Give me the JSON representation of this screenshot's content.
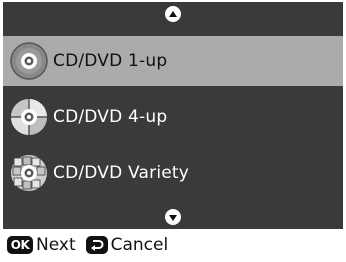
{
  "menu": {
    "items": [
      {
        "label": "CD/DVD 1-up",
        "icon": "disc-1up-icon",
        "selected": true
      },
      {
        "label": "CD/DVD 4-up",
        "icon": "disc-4up-icon",
        "selected": false
      },
      {
        "label": "CD/DVD Variety",
        "icon": "disc-variety-icon",
        "selected": false
      }
    ]
  },
  "footer": {
    "ok_key": "OK",
    "ok_label": "Next",
    "back_label": "Cancel"
  },
  "colors": {
    "screen_bg": "#3a3a3a",
    "selected_bg": "#ababab",
    "text_light": "#ffffff",
    "text_dark": "#111111"
  }
}
